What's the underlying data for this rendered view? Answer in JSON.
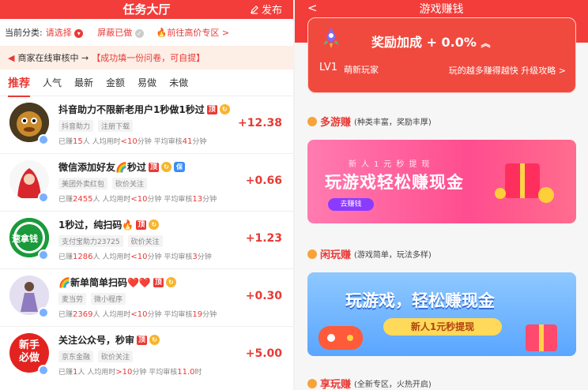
{
  "left": {
    "header": {
      "title": "任务大厅",
      "publish": "发布"
    },
    "filter": {
      "current_label": "当前分类:",
      "select_value": "请选择",
      "shield_label": "屏蔽已做",
      "high_label": "前往高价专区 >"
    },
    "notice": {
      "text": "商家在线审核中 →",
      "link": "【成功填一份问卷，可自提】"
    },
    "tabs": [
      "推荐",
      "人气",
      "最新",
      "金额",
      "易做",
      "未做"
    ],
    "tasks": [
      {
        "name": "抖音助力不限新老用户1秒做1秒过",
        "tags": [
          "抖音助力",
          "注册下载"
        ],
        "done_pre": "已赚",
        "done": "15",
        "done_suf": "人 人均用时",
        "time": "<10",
        "time_suf": "分钟 平均审核",
        "review": "41",
        "review_suf": "分钟",
        "amount": "+12.38"
      },
      {
        "name": "微信添加好友🌈秒过",
        "tags": [
          "美团外卖红包",
          "砍价关注"
        ],
        "done_pre": "已赚",
        "done": "2455",
        "done_suf": "人 人均用时",
        "time": "<10",
        "time_suf": "分钟 平均审核",
        "review": "13",
        "review_suf": "分钟",
        "amount": "+0.66"
      },
      {
        "name": "1秒过，纯扫码🔥",
        "tags": [
          "支付宝助力23725",
          "砍价关注"
        ],
        "done_pre": "已赚",
        "done": "1286",
        "done_suf": "人 人均用时",
        "time": "<10",
        "time_suf": "分钟 平均审核",
        "review": "3",
        "review_suf": "分钟",
        "amount": "+1.23"
      },
      {
        "name": "🌈新单简单扫码❤️❤️",
        "tags": [
          "麦当劳",
          "微小程序"
        ],
        "done_pre": "已赚",
        "done": "2369",
        "done_suf": "人 人均用时",
        "time": "<10",
        "time_suf": "分钟 平均审核",
        "review": "19",
        "review_suf": "分钟",
        "amount": "+0.30"
      },
      {
        "name": "关注公众号，秒审",
        "tags": [
          "京东金融",
          "砍价关注"
        ],
        "done_pre": "已赚",
        "done": "1",
        "done_suf": "人 人均用时",
        "time": ">10",
        "time_suf": "分钟 平均审核",
        "review": "11.0",
        "review_suf": "时",
        "amount": "+5.00"
      }
    ],
    "tag_ding": "顶",
    "tag_bao": "保",
    "avatar3_text": "速拿钱",
    "avatar5_text": "新手必做"
  },
  "right": {
    "header": {
      "title": "游戏赚钱",
      "back": "<"
    },
    "card": {
      "bonus": "奖励加成 + 0.0%",
      "level": "LV1",
      "level_name": "萌新玩家",
      "hint": "玩的越多赚得越快 升级攻略 >"
    },
    "sections": [
      {
        "title": "多游赚",
        "sub": "(种类丰富，奖励丰厚)"
      },
      {
        "title": "闲玩赚",
        "sub": "(游戏简单，玩法多样)"
      },
      {
        "title": "享玩赚",
        "sub": "(全新专区，火热开启)"
      }
    ],
    "banner1": {
      "top": "新人1元秒提现",
      "big": "玩游戏轻松赚现金",
      "button": "去赚钱"
    },
    "banner2": {
      "big": "玩游戏，轻松赚现金",
      "button": "新人1元秒提现"
    }
  }
}
